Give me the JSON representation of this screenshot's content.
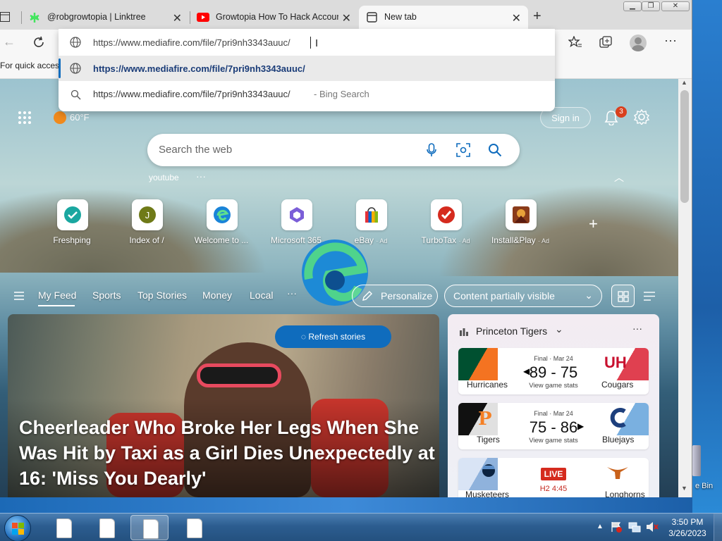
{
  "tabs": [
    {
      "title": "@robgrowtopia | Linktree",
      "icon": "linktree-icon"
    },
    {
      "title": "Growtopia How To Hack Account",
      "icon": "youtube-icon"
    },
    {
      "title": "New tab",
      "icon": "newtab-icon"
    }
  ],
  "favorites_bar": {
    "text": "For quick access"
  },
  "address": {
    "value": "https://www.mediafire.com/file/7pri9nh3343auuc/",
    "suggestions": [
      {
        "text": "https://www.mediafire.com/file/7pri9nh3343auuc/",
        "icon": "globe-icon"
      },
      {
        "text": "https://www.mediafire.com/file/7pri9nh3343auuc/",
        "suffix": "- Bing Search",
        "icon": "search-icon"
      }
    ]
  },
  "newtab": {
    "weather": "60°F",
    "sign_in": "Sign in",
    "notification_count": "3",
    "search_placeholder": "Search the web",
    "recent_search": "youtube",
    "quick_links": [
      {
        "label": "Freshping",
        "ad": ""
      },
      {
        "label": "Index of /",
        "ad": ""
      },
      {
        "label": "Welcome to ...",
        "ad": ""
      },
      {
        "label": "Microsoft 365",
        "ad": ""
      },
      {
        "label": "eBay",
        "ad": "· Ad"
      },
      {
        "label": "TurboTax",
        "ad": "· Ad"
      },
      {
        "label": "Install&Play",
        "ad": "· Ad"
      }
    ],
    "feed_nav": [
      "My Feed",
      "Sports",
      "Top Stories",
      "Money",
      "Local",
      "···"
    ],
    "personalize": "Personalize",
    "content_visibility": "Content partially visible",
    "refresh": "Refresh stories",
    "headline": "Cheerleader Who Broke Her Legs When She Was Hit by Taxi as a Girl Dies Unexpectedly at 16: 'Miss You Dearly'",
    "sports": {
      "title": "Princeton Tigers",
      "games": [
        {
          "status": "Final · Mar 24",
          "home": "Hurricanes",
          "away": "Cougars",
          "score": "89 - 75",
          "stats": "View game stats"
        },
        {
          "status": "Final · Mar 24",
          "home": "Tigers",
          "away": "Bluejays",
          "score": "75 - 86",
          "stats": "View game stats"
        },
        {
          "status": "LIVE",
          "home": "Musketeers",
          "away": "Longhorns",
          "score": "",
          "stats": "H2 4:45"
        }
      ]
    }
  },
  "desktop": {
    "recycle_label": "e Bin"
  },
  "taskbar": {
    "time": "3:50 PM",
    "date": "3/26/2023"
  }
}
